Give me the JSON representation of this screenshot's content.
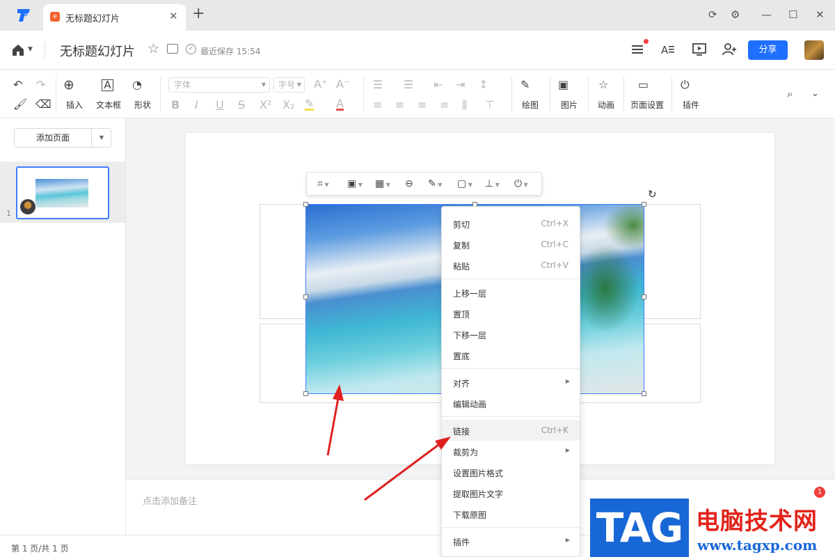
{
  "tab": {
    "title": "无标题幻灯片"
  },
  "header": {
    "doc_title": "无标题幻灯片",
    "save_status": "最近保存 15:54",
    "share_label": "分享"
  },
  "toolbar": {
    "insert": "插入",
    "textbox": "文本框",
    "shape": "形状",
    "font_placeholder": "字体",
    "size_placeholder": "字号",
    "draw": "绘图",
    "picture": "图片",
    "animation": "动画",
    "page_setup": "页面设置",
    "plugin": "插件"
  },
  "left_panel": {
    "add_page": "添加页面",
    "slide_number": "1"
  },
  "notes": {
    "placeholder": "点击添加备注"
  },
  "status": {
    "page_info": "第 1 页/共 1 页"
  },
  "notification_count": "1",
  "context_menu": {
    "items": [
      {
        "label": "剪切",
        "shortcut": "Ctrl+X"
      },
      {
        "label": "复制",
        "shortcut": "Ctrl+C"
      },
      {
        "label": "粘贴",
        "shortcut": "Ctrl+V"
      },
      {
        "label": "上移一层"
      },
      {
        "label": "置顶"
      },
      {
        "label": "下移一层"
      },
      {
        "label": "置底"
      },
      {
        "label": "对齐"
      },
      {
        "label": "编辑动画"
      },
      {
        "label": "链接",
        "shortcut": "Ctrl+K"
      },
      {
        "label": "裁剪为"
      },
      {
        "label": "设置图片格式"
      },
      {
        "label": "提取图片文字"
      },
      {
        "label": "下载原图"
      },
      {
        "label": "插件"
      }
    ]
  },
  "watermark": {
    "logo": "TAG",
    "site_name": "电脑技术网",
    "url": "www.tagxp.com"
  },
  "colors": {
    "accent": "#1e6fff",
    "selection": "#3d7eff",
    "arrow": "#e02020"
  }
}
